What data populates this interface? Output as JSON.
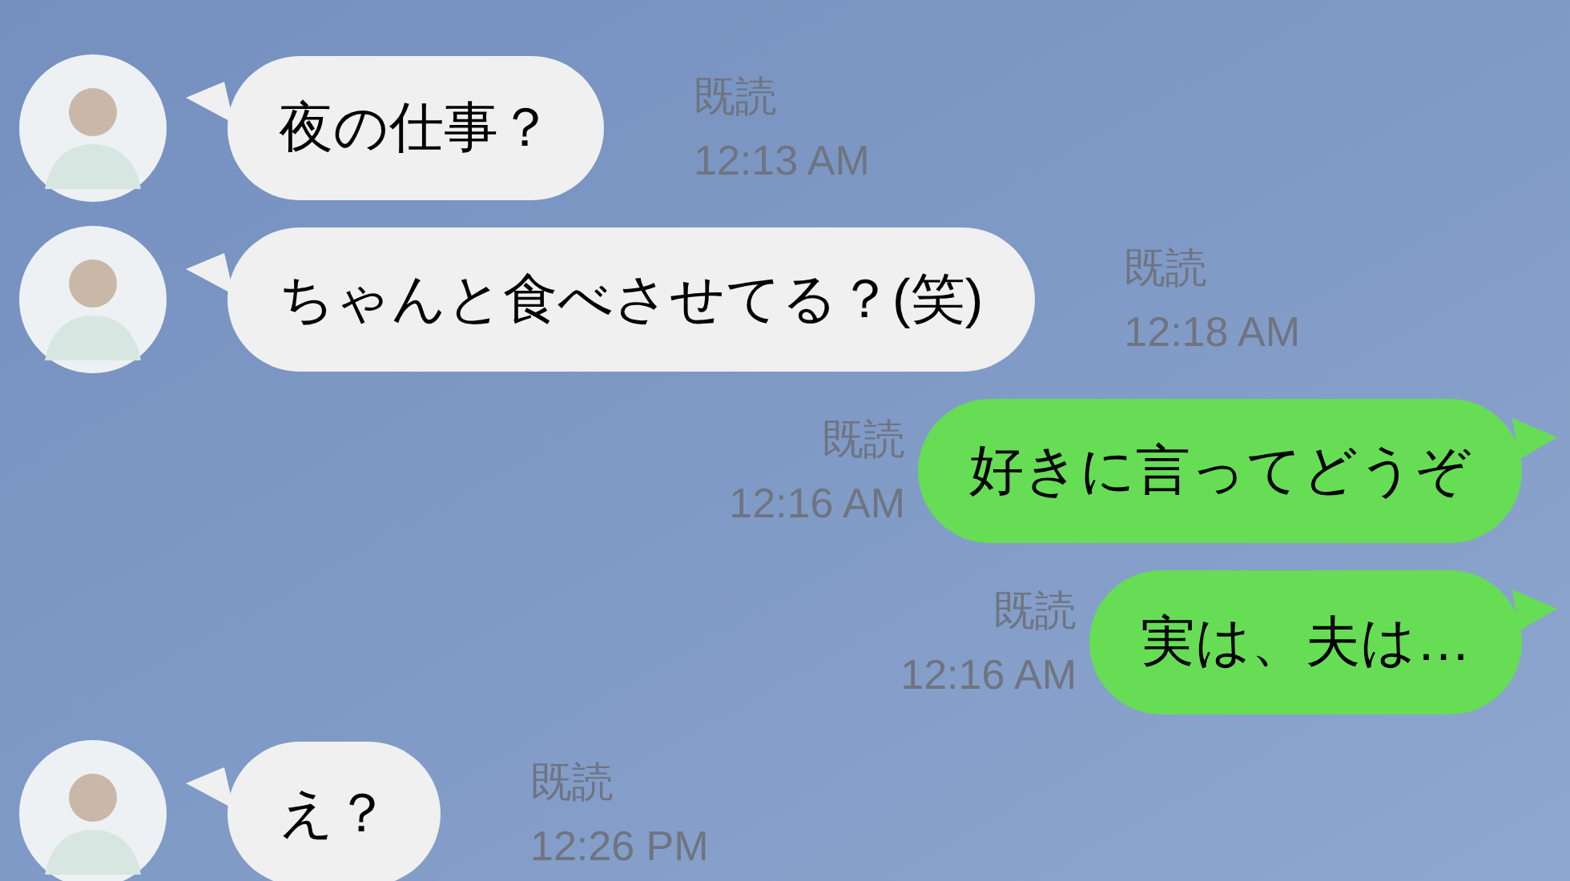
{
  "messages": [
    {
      "kind": "received",
      "text": "夜の仕事？",
      "read": "既読",
      "time": "12:13 AM"
    },
    {
      "kind": "received",
      "text": "ちゃんと食べさせてる？(笑)",
      "read": "既読",
      "time": "12:18 AM"
    },
    {
      "kind": "sent",
      "text": "好きに言ってどうぞ",
      "read": "既読",
      "time": "12:16 AM"
    },
    {
      "kind": "sent",
      "text": "実は、夫は…",
      "read": "既読",
      "time": "12:16 AM"
    },
    {
      "kind": "received",
      "text": "え？",
      "read": "既読",
      "time": "12:26 PM"
    }
  ]
}
